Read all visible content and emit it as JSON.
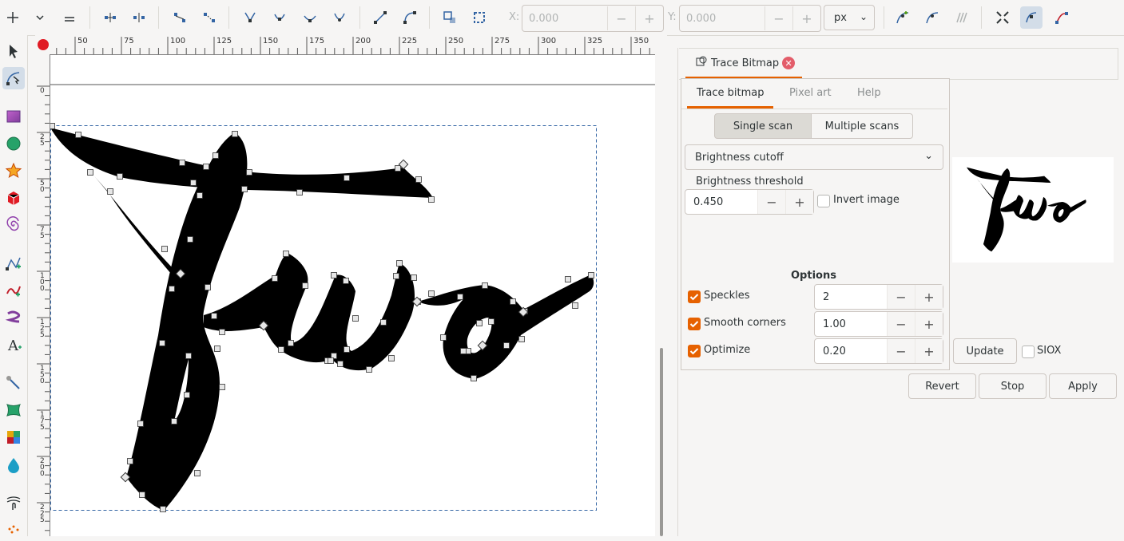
{
  "toolbar": {
    "x_label": "X:",
    "x_value": "0.000",
    "y_label": "Y:",
    "y_value": "0.000",
    "minus": "−",
    "plus": "+",
    "unit": "px"
  },
  "ruler": {
    "top_ticks": [
      "50",
      "75",
      "100",
      "125",
      "150",
      "175",
      "200",
      "225",
      "250",
      "275",
      "300",
      "325",
      "350"
    ],
    "left_ticks": [
      "0",
      "2\n5",
      "5\n0",
      "7\n5",
      "1\n0\n0",
      "1\n2\n5",
      "1\n5\n0",
      "1\n7\n5",
      "2\n0\n0",
      "2\n2\n5"
    ]
  },
  "dialog": {
    "title": "Trace Bitmap",
    "tabs": [
      "Trace bitmap",
      "Pixel art",
      "Help"
    ],
    "scan_modes": [
      "Single scan",
      "Multiple scans"
    ],
    "mode_select": "Brightness cutoff",
    "threshold_label": "Brightness threshold",
    "threshold_value": "0.450",
    "invert_label": "Invert image",
    "options_heading": "Options",
    "options": [
      {
        "label": "Speckles",
        "value": "2"
      },
      {
        "label": "Smooth corners",
        "value": "1.00"
      },
      {
        "label": "Optimize",
        "value": "0.20"
      }
    ],
    "update_label": "Update",
    "siox_label": "SIOX",
    "revert_label": "Revert",
    "stop_label": "Stop",
    "apply_label": "Apply"
  },
  "colors": {
    "accent": "#e66100",
    "close": "#e35d6a",
    "node_blue": "#3465a4"
  }
}
